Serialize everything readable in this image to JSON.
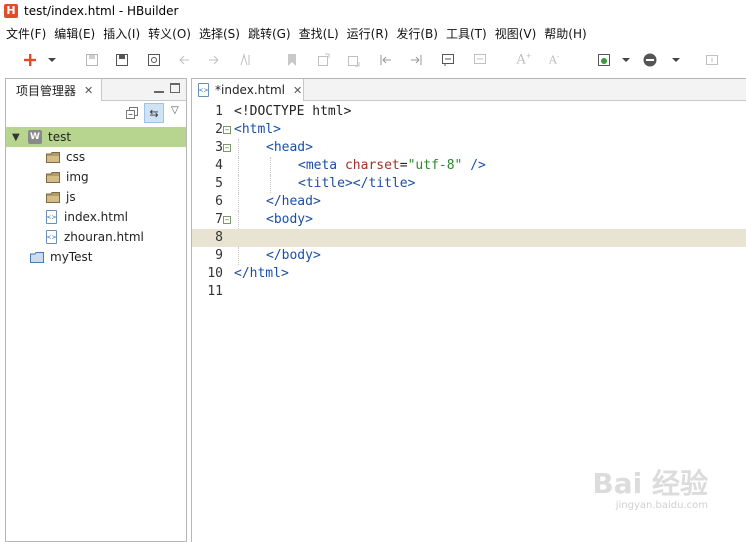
{
  "window": {
    "app_icon_letter": "H",
    "title": "test/index.html  -  HBuilder"
  },
  "menu": {
    "items": [
      "文件(F)",
      "编辑(E)",
      "插入(I)",
      "转义(O)",
      "选择(S)",
      "跳转(G)",
      "查找(L)",
      "运行(R)",
      "发行(B)",
      "工具(T)",
      "视图(V)",
      "帮助(H)"
    ]
  },
  "sidebar": {
    "tab_label": "项目管理器",
    "tree": [
      {
        "label": "test",
        "kind": "project",
        "icon_letter": "W",
        "selected": true,
        "expanded": true
      },
      {
        "label": "css",
        "kind": "folder"
      },
      {
        "label": "img",
        "kind": "folder"
      },
      {
        "label": "js",
        "kind": "folder"
      },
      {
        "label": "index.html",
        "kind": "file"
      },
      {
        "label": "zhouran.html",
        "kind": "file"
      },
      {
        "label": "myTest",
        "kind": "closed-project"
      }
    ]
  },
  "editor": {
    "tab_label": "*index.html",
    "current_line": 8,
    "lines": [
      {
        "n": "1",
        "fold": false,
        "indent": 0,
        "tokens": [
          {
            "t": "<!DOCTYPE html>",
            "c": "plain"
          }
        ]
      },
      {
        "n": "2",
        "fold": true,
        "indent": 0,
        "tokens": [
          {
            "t": "<html>",
            "c": "tag"
          }
        ]
      },
      {
        "n": "3",
        "fold": true,
        "indent": 1,
        "tokens": [
          {
            "t": "<head>",
            "c": "tag"
          }
        ]
      },
      {
        "n": "4",
        "fold": false,
        "indent": 2,
        "tokens": [
          {
            "t": "<meta ",
            "c": "tag"
          },
          {
            "t": "charset",
            "c": "attr"
          },
          {
            "t": "=",
            "c": "plain"
          },
          {
            "t": "\"utf-8\"",
            "c": "str"
          },
          {
            "t": " />",
            "c": "tag"
          }
        ]
      },
      {
        "n": "5",
        "fold": false,
        "indent": 2,
        "tokens": [
          {
            "t": "<title></title>",
            "c": "tag"
          }
        ]
      },
      {
        "n": "6",
        "fold": false,
        "indent": 1,
        "tokens": [
          {
            "t": "</head>",
            "c": "tag"
          }
        ]
      },
      {
        "n": "7",
        "fold": true,
        "indent": 1,
        "tokens": [
          {
            "t": "<body>",
            "c": "tag"
          }
        ]
      },
      {
        "n": "8",
        "fold": false,
        "indent": 0,
        "tokens": []
      },
      {
        "n": "9",
        "fold": false,
        "indent": 1,
        "tokens": [
          {
            "t": "</body>",
            "c": "tag"
          }
        ]
      },
      {
        "n": "10",
        "fold": false,
        "indent": 0,
        "tokens": [
          {
            "t": "</html>",
            "c": "tag"
          }
        ]
      },
      {
        "n": "11",
        "fold": false,
        "indent": 0,
        "tokens": []
      }
    ]
  },
  "colors": {
    "accent_red": "#e04d26",
    "selection_green": "#b7d58f",
    "current_line": "#e9e3d4",
    "tag_blue": "#1a4fa6",
    "attr_red": "#a1322a",
    "string_green": "#2b8a2b"
  },
  "watermark": {
    "main": "Bai 经验",
    "sub": "jingyan.baidu.com"
  }
}
